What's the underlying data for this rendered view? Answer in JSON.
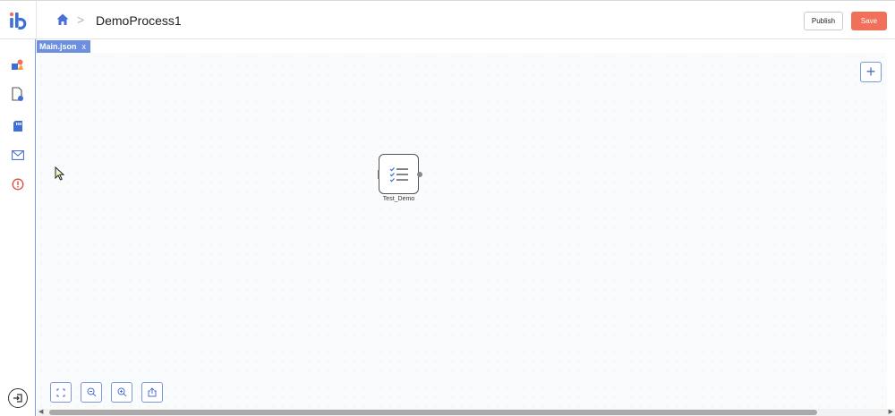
{
  "header": {
    "logo_icon": "ib-logo-icon",
    "home_icon": "home-icon",
    "breadcrumb_separator": ">",
    "process_title": "DemoProcess1",
    "publish_label": "Publish",
    "save_label": "Save"
  },
  "sidebar": {
    "items": [
      {
        "icon": "shapes-icon"
      },
      {
        "icon": "document-settings-icon"
      },
      {
        "icon": "storage-card-icon"
      },
      {
        "icon": "mail-icon"
      },
      {
        "icon": "alert-icon"
      }
    ],
    "exit_icon": "exit-icon"
  },
  "tab": {
    "label": "Main.json",
    "close": "x"
  },
  "canvas": {
    "add_label": "+",
    "node": {
      "label": "Test_Demo",
      "icon": "checklist-icon"
    },
    "zoom_controls": [
      {
        "icon": "fit-screen-icon"
      },
      {
        "icon": "zoom-out-icon"
      },
      {
        "icon": "zoom-in-icon"
      },
      {
        "icon": "export-icon"
      }
    ]
  },
  "colors": {
    "accent": "#6d8fe0",
    "save": "#f0705a",
    "canvas_bg": "#fafbfd"
  }
}
